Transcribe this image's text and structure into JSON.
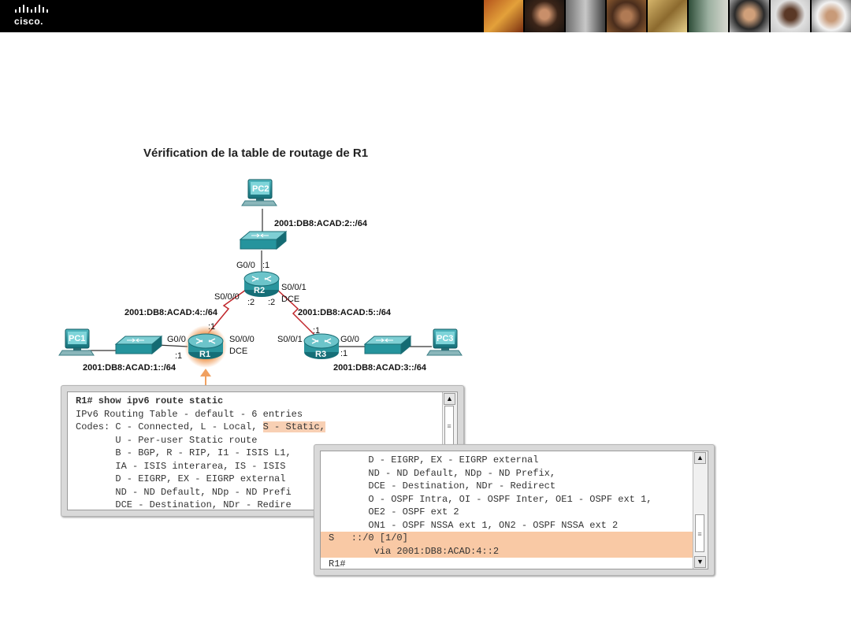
{
  "header": {
    "logo_text": "cisco."
  },
  "title": "Vérification de la table de routage de R1",
  "devices": {
    "pc1": "PC1",
    "pc2": "PC2",
    "pc3": "PC3",
    "r1": "R1",
    "r2": "R2",
    "r3": "R3"
  },
  "labels": {
    "net2": "2001:DB8:ACAD:2::/64",
    "net4": "2001:DB8:ACAD:4::/64",
    "net5": "2001:DB8:ACAD:5::/64",
    "net1": "2001:DB8:ACAD:1::/64",
    "net3": "2001:DB8:ACAD:3::/64",
    "r2_g00": "G0/0",
    "r2_g00_host": ":1",
    "r2_s000": "S0/0/0",
    "r2_s000_host": ":2",
    "r2_s001": "S0/0/1",
    "r2_s001_host": ":2",
    "r2_dce": "DCE",
    "r1_g00": "G0/0",
    "r1_g00_host": ":1",
    "r1_s000": "S0/0/0",
    "r1_s000_host": ":1",
    "r1_dce": "DCE",
    "r3_s001": "S0/0/1",
    "r3_s001_host": ":1",
    "r3_g00": "G0/0",
    "r3_g00_host": ":1"
  },
  "terminal1": {
    "lines": [
      "R1# show ipv6 route static",
      "IPv6 Routing Table - default - 6 entries",
      "Codes: C - Connected, L - Local, ",
      "       U - Per-user Static route",
      "       B - BGP, R - RIP, I1 - ISIS L1,",
      "       IA - ISIS interarea, IS - ISIS",
      "       D - EIGRP, EX - EIGRP external",
      "       ND - ND Default, NDp - ND Prefi",
      "       DCE - Destination, NDr - Redire"
    ],
    "highlight": "S - Static,"
  },
  "terminal2": {
    "lines": [
      "       D - EIGRP, EX - EIGRP external",
      "       ND - ND Default, NDp - ND Prefix,",
      "       DCE - Destination, NDr - Redirect",
      "       O - OSPF Intra, OI - OSPF Inter, OE1 - OSPF ext 1,",
      "       OE2 - OSPF ext 2",
      "       ON1 - OSPF NSSA ext 1, ON2 - OSPF NSSA ext 2",
      "S   ::/0 [1/0]",
      "        via 2001:DB8:ACAD:4::2",
      "R1#"
    ]
  },
  "colors": {
    "accent": "#f0a060",
    "highlight": "#f9c9a5",
    "device": "#1f8c96",
    "serial_link": "#c0262b"
  }
}
